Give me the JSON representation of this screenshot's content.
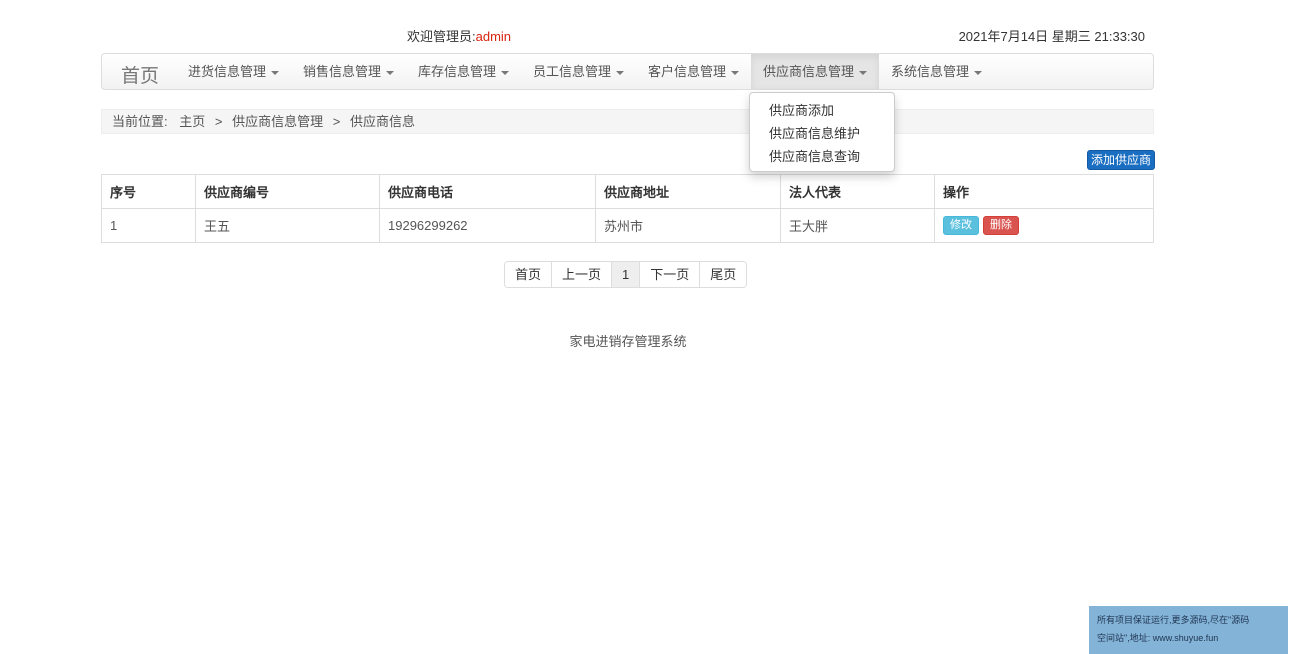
{
  "header": {
    "welcome_label": "欢迎管理员:",
    "username": "admin",
    "datetime": "2021年7月14日 星期三 21:33:30"
  },
  "nav": {
    "brand": "首页",
    "items": [
      {
        "label": "进货信息管理"
      },
      {
        "label": "销售信息管理"
      },
      {
        "label": "库存信息管理"
      },
      {
        "label": "员工信息管理"
      },
      {
        "label": "客户信息管理"
      },
      {
        "label": "供应商信息管理"
      },
      {
        "label": "系统信息管理"
      }
    ],
    "dropdown": [
      "供应商添加",
      "供应商信息维护",
      "供应商信息查询"
    ]
  },
  "breadcrumb": {
    "prefix": "当前位置:",
    "path": [
      "主页",
      "供应商信息管理",
      "供应商信息"
    ],
    "separator": ">"
  },
  "toolbar": {
    "add_label": "添加供应商"
  },
  "table": {
    "headers": [
      "序号",
      "供应商编号",
      "供应商电话",
      "供应商地址",
      "法人代表",
      "操作"
    ],
    "rows": [
      [
        "1",
        "王五",
        "19296299262",
        "苏州市",
        "王大胖"
      ]
    ],
    "edit_label": "修改",
    "delete_label": "删除"
  },
  "pagination": {
    "first": "首页",
    "prev": "上一页",
    "current": "1",
    "next": "下一页",
    "last": "尾页"
  },
  "footer": "家电进销存管理系统",
  "ad": {
    "line1": "所有项目保证运行,更多源码,尽在\"源码",
    "line2": "空间站\",地址: www.shuyue.fun"
  },
  "colors": {
    "accent": "#1a6ec2",
    "username": "#d9230f",
    "edit": "#5bc0de",
    "delete": "#d9534f"
  }
}
